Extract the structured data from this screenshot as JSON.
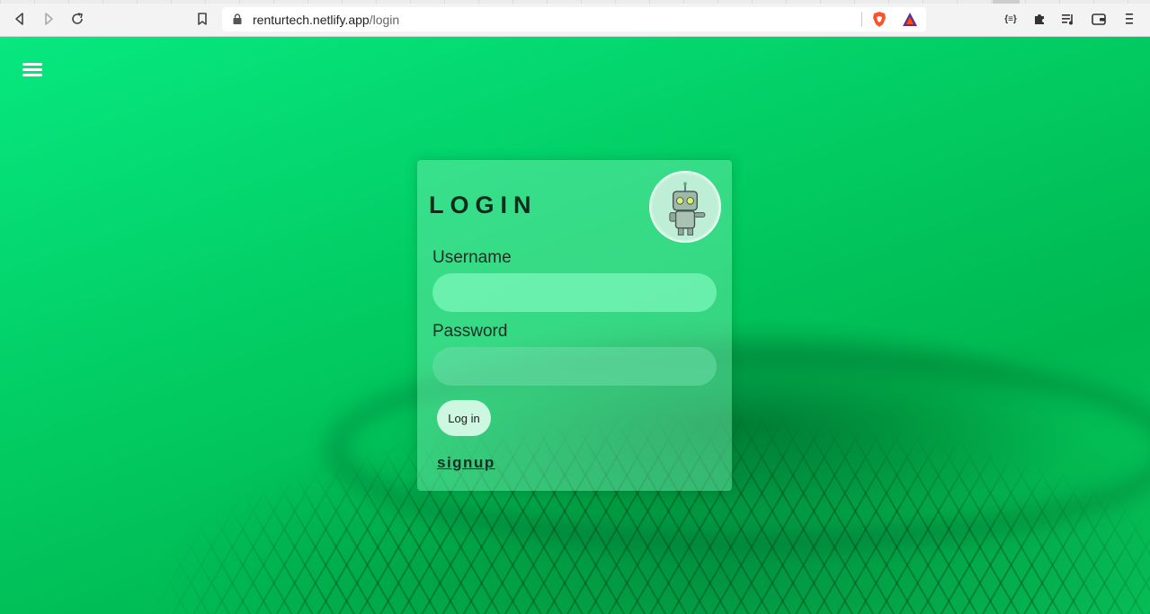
{
  "browser": {
    "url_host": "renturtech.netlify.app",
    "url_path": "/login",
    "icons": {
      "back": "back-icon",
      "forward": "forward-icon",
      "reload": "reload-icon",
      "bookmark": "bookmark-icon",
      "lock": "lock-icon",
      "brave_shields": "brave-shields-icon",
      "brave_rewards": "brave-rewards-icon",
      "json_ext": "json-extension-icon",
      "extensions": "puzzle-icon",
      "playlist": "playlist-icon",
      "wallet": "wallet-icon",
      "menu": "menu-icon"
    },
    "json_ext_label": "{≡}"
  },
  "page": {
    "menu_icon": "hamburger-icon",
    "login_card": {
      "title": "LOGIN",
      "username_label": "Username",
      "username_value": "",
      "password_label": "Password",
      "password_value": "",
      "login_button": "Log in",
      "signup_link": "signup",
      "mascot": "robot-avatar"
    }
  },
  "colors": {
    "background": "#02cc63",
    "card": "#78f0b4",
    "title": "#102a1c"
  }
}
